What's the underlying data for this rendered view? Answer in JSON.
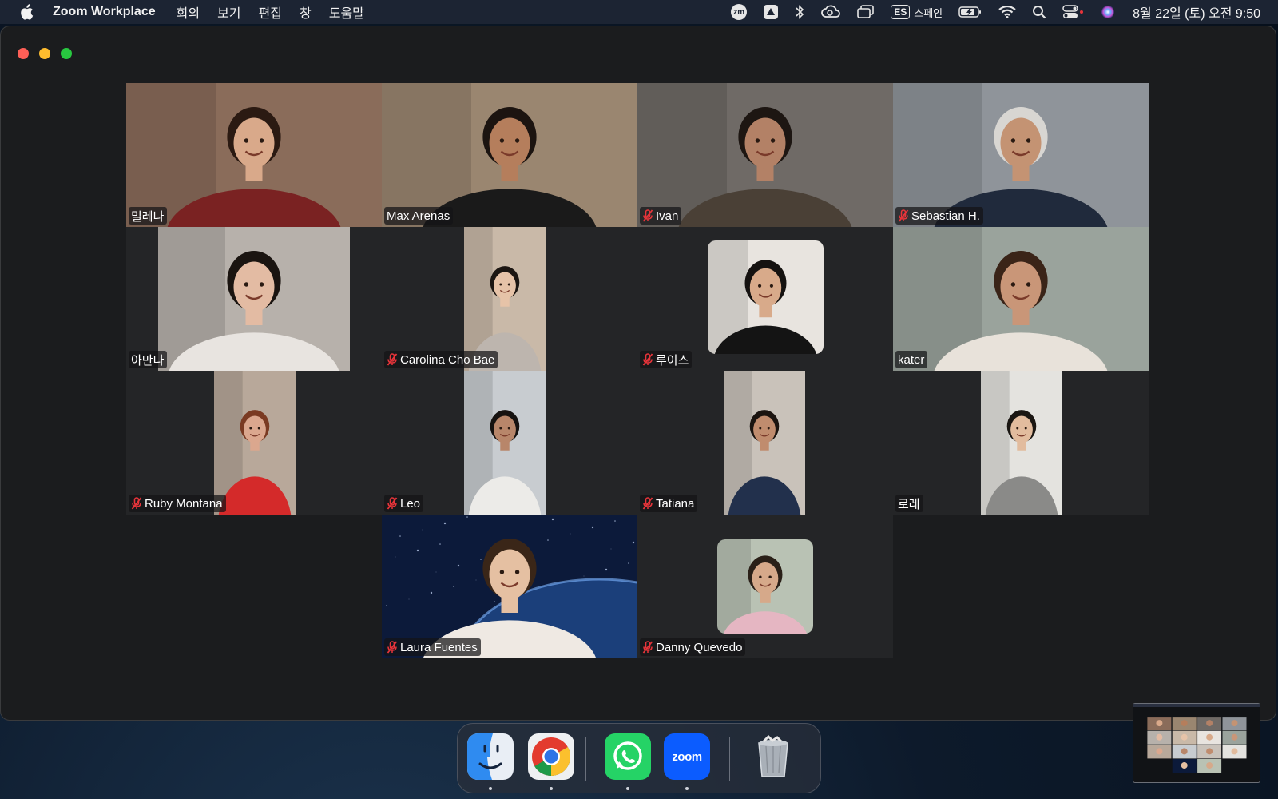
{
  "menubar": {
    "app_name": "Zoom Workplace",
    "menus": [
      "회의",
      "보기",
      "편집",
      "창",
      "도움말"
    ],
    "status": {
      "zoom_badge": "zm",
      "input_source_code": "ES",
      "input_source_name": "스페인",
      "datetime": "8월 22일 (토) 오전 9:50"
    }
  },
  "window": {
    "title_buttons": [
      "close",
      "minimize",
      "zoom"
    ]
  },
  "participants": [
    {
      "name": "밀레나",
      "muted": false,
      "active_speaker": false,
      "bg": "#8a6c5a",
      "skin": "#d9a98a",
      "shirt": "#7a2222",
      "hair": "#2b1a12"
    },
    {
      "name": "Max Arenas",
      "muted": false,
      "active_speaker": true,
      "bg": "#9a8670",
      "skin": "#b57e5c",
      "shirt": "#1a1a1a",
      "hair": "#1c1410"
    },
    {
      "name": "Ivan",
      "muted": true,
      "active_speaker": false,
      "bg": "#6f6a66",
      "skin": "#b38166",
      "shirt": "#4a4036",
      "hair": "#1d1612"
    },
    {
      "name": "Sebastian H.",
      "muted": true,
      "active_speaker": false,
      "bg": "#8f949a",
      "skin": "#c49373",
      "shirt": "#202a3c",
      "hair": "#d8d6d2"
    },
    {
      "name": "아만다",
      "muted": false,
      "active_speaker": false,
      "bg": "#b7b1ab",
      "skin": "#e3bba3",
      "shirt": "#e8e4e0",
      "hair": "#1a1410"
    },
    {
      "name": "Carolina Cho Bae",
      "muted": true,
      "active_speaker": false,
      "bg": "#c9b9a8",
      "skin": "#e6c3a8",
      "shirt": "#bdb5ae",
      "hair": "#1c1612"
    },
    {
      "name": "루이스",
      "muted": true,
      "active_speaker": false,
      "bg": "#e8e4df",
      "skin": "#d8aa8a",
      "shirt": "#141414",
      "hair": "#151210"
    },
    {
      "name": "kater",
      "muted": false,
      "active_speaker": false,
      "bg": "#9aa39c",
      "skin": "#c99678",
      "shirt": "#e8e2da",
      "hair": "#3a2418"
    },
    {
      "name": "Ruby Montana",
      "muted": true,
      "active_speaker": false,
      "bg": "#b8a89a",
      "skin": "#dba78e",
      "shirt": "#d42a2a",
      "hair": "#7a3a22"
    },
    {
      "name": "Leo",
      "muted": true,
      "active_speaker": false,
      "bg": "#c8ccd0",
      "skin": "#b8866a",
      "shirt": "#ecebe8",
      "hair": "#161210"
    },
    {
      "name": "Tatiana",
      "muted": true,
      "active_speaker": false,
      "bg": "#c9c2ba",
      "skin": "#c08c6e",
      "shirt": "#22304c",
      "hair": "#1b1410"
    },
    {
      "name": "로레",
      "muted": false,
      "active_speaker": false,
      "bg": "#e4e3df",
      "skin": "#e2bc9e",
      "shirt": "#8a8a88",
      "hair": "#1a1612"
    },
    {
      "name": "Laura Fuentes",
      "muted": true,
      "active_speaker": false,
      "bg": "#0c1a3a",
      "skin": "#e5c0a2",
      "shirt": "#efe9e3",
      "hair": "#3a2618"
    },
    {
      "name": "Danny Quevedo",
      "muted": true,
      "active_speaker": false,
      "bg": "#b9c2b4",
      "skin": "#d6a98a",
      "shirt": "#e5b6c2",
      "hair": "#2a2018"
    }
  ],
  "dock": {
    "apps": [
      {
        "name": "Finder",
        "running": true
      },
      {
        "name": "Google Chrome",
        "running": true
      },
      {
        "name": "WhatsApp",
        "running": true
      },
      {
        "name": "zoom",
        "running": true
      },
      {
        "name": "Trash",
        "running": false
      }
    ]
  },
  "colors": {
    "active_speaker_border": "#3fd13f",
    "muted_icon": "#e8343a",
    "zoom_blue": "#0b5cff",
    "whatsapp_green": "#25d366"
  }
}
